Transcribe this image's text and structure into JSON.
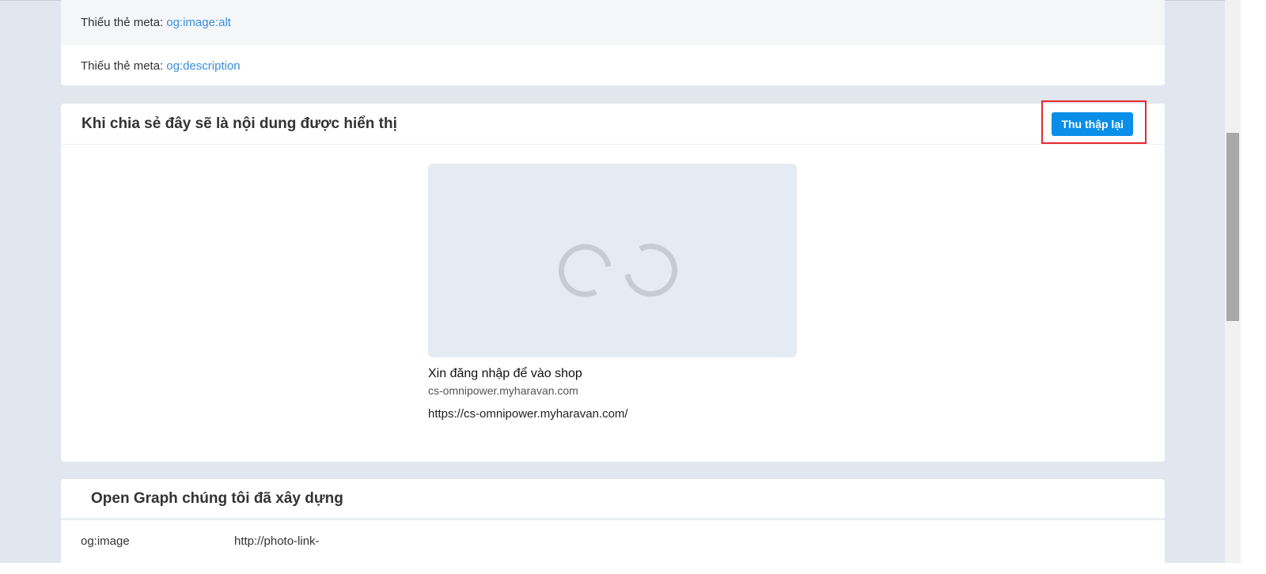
{
  "missing_meta": [
    {
      "label": "Thiếu thẻ meta:",
      "tag": "og:image:alt"
    },
    {
      "label": "Thiếu thẻ meta:",
      "tag": "og:description"
    }
  ],
  "share_card": {
    "title": "Khi chia sẻ đây sẽ là nội dung được hiển thị",
    "recollect_button": "Thu thập lại",
    "preview_title": "Xin đăng nhập để vào shop",
    "preview_domain": "cs-omnipower.myharavan.com",
    "preview_url": "https://cs-omnipower.myharavan.com/"
  },
  "og_card": {
    "title": "Open Graph chúng tôi đã xây dựng",
    "rows": [
      {
        "key": "og:image",
        "value": "http://photo-link-"
      }
    ]
  }
}
